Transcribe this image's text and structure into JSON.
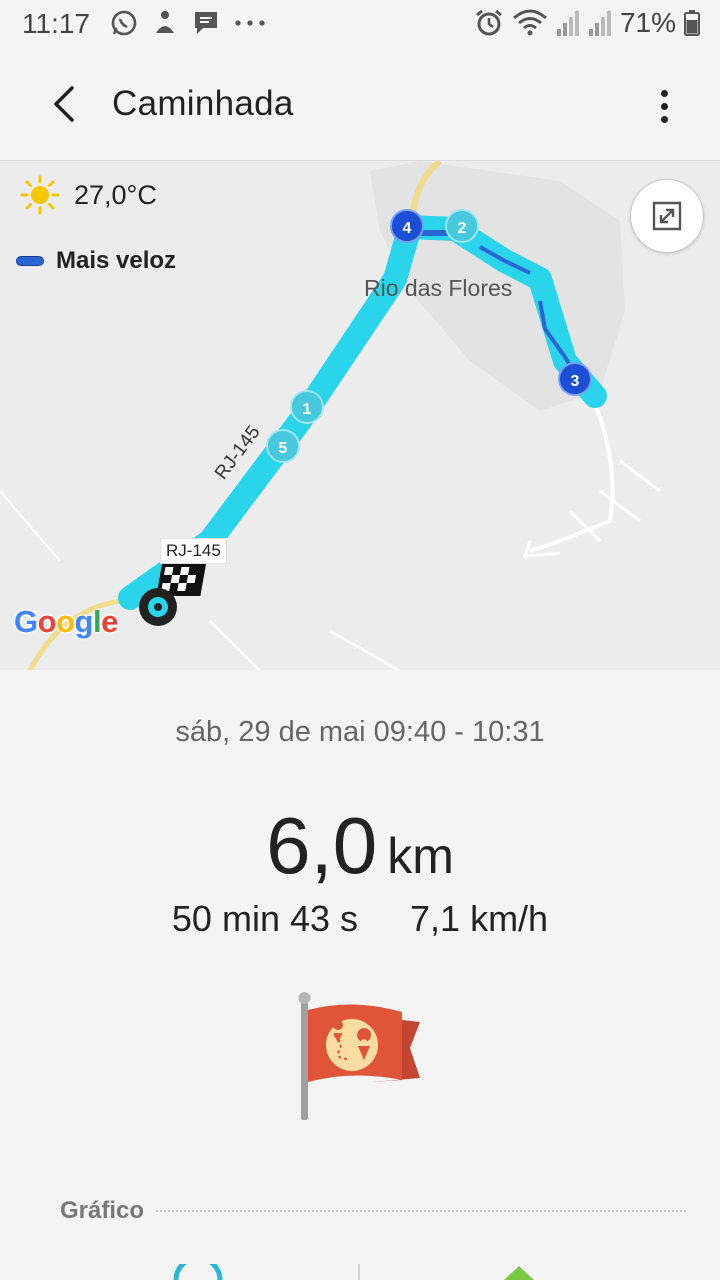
{
  "status_bar": {
    "time": "11:17",
    "battery_percent": "71%",
    "left_icons": [
      "whatsapp-icon",
      "notification-icon",
      "message-icon",
      "more-notifications-icon"
    ],
    "right_icons": [
      "alarm-icon",
      "wifi-icon",
      "signal-icon",
      "signal-icon-2",
      "battery-icon"
    ]
  },
  "app_bar": {
    "title": "Caminhada",
    "back_icon": "arrow-left-icon",
    "menu_icon": "more-vertical-icon"
  },
  "map": {
    "temperature": "27,0°C",
    "weather_icon": "sun-icon",
    "legend_label": "Mais veloz",
    "legend_color": "#2a65d6",
    "route_color": "#2ad4ea",
    "place_label": "Rio das Flores",
    "road_label": "RJ-145",
    "road_sign": "RJ-145",
    "markers": [
      "1",
      "2",
      "3",
      "4",
      "5"
    ],
    "attribution": {
      "letters": [
        "G",
        "o",
        "o",
        "g",
        "l",
        "e"
      ],
      "colors": [
        "#4285f4",
        "#ea4335",
        "#fbbc05",
        "#4285f4",
        "#34a853",
        "#ea4335"
      ]
    }
  },
  "workout": {
    "datetime": "sáb, 29 de mai 09:40 - 10:31",
    "distance_value": "6,0",
    "distance_unit": "km",
    "duration": "50 min 43 s",
    "speed": "7,1 km/h"
  },
  "section": {
    "chart_title": "Gráfico"
  }
}
